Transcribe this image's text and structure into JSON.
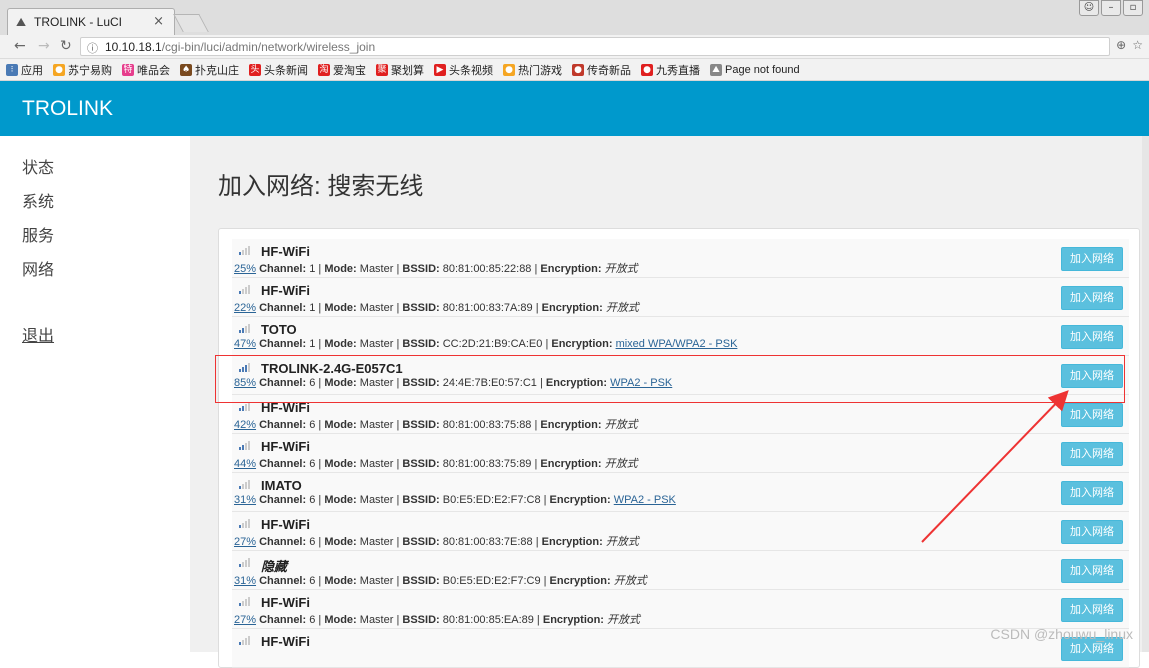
{
  "browser": {
    "tab_title": "TROLINK - LuCI",
    "tab_close": "×",
    "url_host": "10.10.18.1",
    "url_path": "/cgi-bin/luci/admin/network/wireless_join",
    "bookmarks": [
      {
        "label": "应用",
        "icon_color": "#4a7ab5"
      },
      {
        "label": "苏宁易购",
        "icon_color": "#f5a623"
      },
      {
        "label": "唯品会",
        "icon_color": "#e63d8c"
      },
      {
        "label": "扑克山庄",
        "icon_color": "#7a4a1f"
      },
      {
        "label": "头条新闻",
        "icon_color": "#e02020"
      },
      {
        "label": "爱淘宝",
        "icon_color": "#e02020"
      },
      {
        "label": "聚划算",
        "icon_color": "#e02020"
      },
      {
        "label": "头条视频",
        "icon_color": "#e02020"
      },
      {
        "label": "热门游戏",
        "icon_color": "#f5a623"
      },
      {
        "label": "传奇新品",
        "icon_color": "#c0392b"
      },
      {
        "label": "九秀直播",
        "icon_color": "#e02020"
      },
      {
        "label": "Page not found",
        "icon_color": "#888888"
      }
    ]
  },
  "header": {
    "brand": "TROLINK",
    "color": "#0099cc"
  },
  "sidebar": {
    "items": [
      {
        "label": "状态"
      },
      {
        "label": "系统"
      },
      {
        "label": "服务"
      },
      {
        "label": "网络"
      }
    ],
    "logout": "退出"
  },
  "main": {
    "title": "加入网络: 搜索无线",
    "labels": {
      "channel": "Channel:",
      "mode": "Mode:",
      "bssid": "BSSID:",
      "encryption": "Encryption:"
    },
    "join_label": "加入网络",
    "networks": [
      {
        "ssid": "HF-WiFi",
        "signal": "25%",
        "signal_level": 0.25,
        "channel": "1",
        "mode": "Master",
        "bssid": "80:81:00:85:22:88",
        "encryption": "开放式",
        "enc_link": false
      },
      {
        "ssid": "HF-WiFi",
        "signal": "22%",
        "signal_level": 0.22,
        "channel": "1",
        "mode": "Master",
        "bssid": "80:81:00:83:7A:89",
        "encryption": "开放式",
        "enc_link": false
      },
      {
        "ssid": "TOTO",
        "signal": "47%",
        "signal_level": 0.47,
        "channel": "1",
        "mode": "Master",
        "bssid": "CC:2D:21:B9:CA:E0",
        "encryption": "mixed WPA/WPA2 - PSK",
        "enc_link": true
      },
      {
        "ssid": "TROLINK-2.4G-E057C1",
        "signal": "85%",
        "signal_level": 0.85,
        "channel": "6",
        "mode": "Master",
        "bssid": "24:4E:7B:E0:57:C1",
        "encryption": "WPA2 - PSK",
        "enc_link": true
      },
      {
        "ssid": "HF-WiFi",
        "signal": "42%",
        "signal_level": 0.42,
        "channel": "6",
        "mode": "Master",
        "bssid": "80:81:00:83:75:88",
        "encryption": "开放式",
        "enc_link": false
      },
      {
        "ssid": "HF-WiFi",
        "signal": "44%",
        "signal_level": 0.44,
        "channel": "6",
        "mode": "Master",
        "bssid": "80:81:00:83:75:89",
        "encryption": "开放式",
        "enc_link": false
      },
      {
        "ssid": "IMATO",
        "signal": "31%",
        "signal_level": 0.31,
        "channel": "6",
        "mode": "Master",
        "bssid": "B0:E5:ED:E2:F7:C8",
        "encryption": "WPA2 - PSK",
        "enc_link": true
      },
      {
        "ssid": "HF-WiFi",
        "signal": "27%",
        "signal_level": 0.27,
        "channel": "6",
        "mode": "Master",
        "bssid": "80:81:00:83:7E:88",
        "encryption": "开放式",
        "enc_link": false
      },
      {
        "ssid": "隐藏",
        "signal": "31%",
        "signal_level": 0.31,
        "channel": "6",
        "mode": "Master",
        "bssid": "B0:E5:ED:E2:F7:C9",
        "encryption": "开放式",
        "enc_link": false,
        "hidden": true
      },
      {
        "ssid": "HF-WiFi",
        "signal": "27%",
        "signal_level": 0.27,
        "channel": "6",
        "mode": "Master",
        "bssid": "80:81:00:85:EA:89",
        "encryption": "开放式",
        "enc_link": false
      },
      {
        "ssid": "HF-WiFi"
      }
    ]
  },
  "watermark": "CSDN @zhouwu_linux",
  "annotation_color": "#e33333"
}
